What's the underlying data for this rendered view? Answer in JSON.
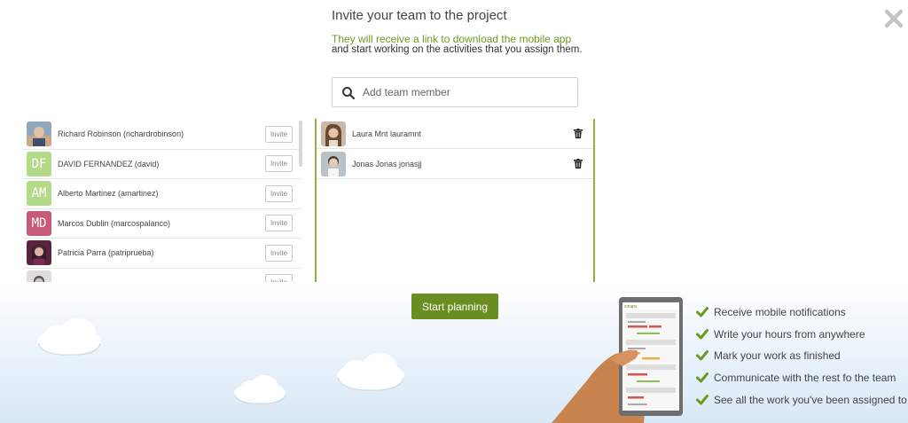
{
  "header": {
    "title": "Invite your team to the project",
    "subtitle_green": "They will receive a link to download the mobile app",
    "subtitle_rest": "and start working on the activities that you assign them."
  },
  "search": {
    "placeholder": "Add team member",
    "value": ""
  },
  "available_members": [
    {
      "name": "Richard Robinson (richardrobinson)",
      "avatar_type": "photo",
      "invite_label": "Invite"
    },
    {
      "name": "DAVID FERNANDEZ (david)",
      "avatar_type": "initials",
      "initials": "DF",
      "color": "#b5d98a",
      "invite_label": "Invite"
    },
    {
      "name": "Alberto Martinez (amartinez)",
      "avatar_type": "initials",
      "initials": "AM",
      "color": "#b5d98a",
      "invite_label": "Invite"
    },
    {
      "name": "Marcos Dublin (marcospalanco)",
      "avatar_type": "initials",
      "initials": "MD",
      "color": "#c75a78",
      "invite_label": "Invite"
    },
    {
      "name": "Patricia Parra (patriprueba)",
      "avatar_type": "photo",
      "invite_label": "Invite"
    },
    {
      "name": "",
      "avatar_type": "photo",
      "invite_label": "Invite"
    }
  ],
  "team_members": [
    {
      "name": "Laura Mnt lauramnt",
      "avatar_type": "photo"
    },
    {
      "name": "Jonas Jonas jonasjj",
      "avatar_type": "photo"
    }
  ],
  "actions": {
    "start_label": "Start planning"
  },
  "features": [
    "Receive mobile notifications",
    "Write your hours from anywhere",
    "Mark your work as finished",
    "Communicate with the rest fo the team",
    "See all the work you've been assigned to"
  ],
  "colors": {
    "accent": "#6b8e23",
    "panel_border": "#8bb33a",
    "check": "#6a9a1f",
    "subtitle": "#6a9a1f"
  },
  "icons": {
    "close": "close-x-icon",
    "search": "search-icon",
    "delete": "trash-icon",
    "check": "check-icon"
  }
}
